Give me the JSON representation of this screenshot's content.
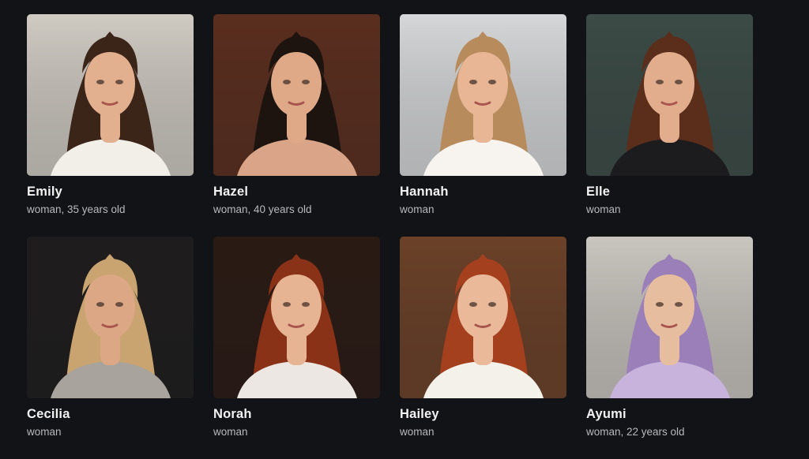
{
  "profiles": [
    {
      "name": "Emily",
      "meta": "woman, 35 years old",
      "bg": "#cfcac2",
      "hair": "#3b2418",
      "skin": "#e3b08f",
      "top": "#f2eee8"
    },
    {
      "name": "Hazel",
      "meta": "woman, 40 years old",
      "bg": "#5a2e1e",
      "hair": "#1d1410",
      "skin": "#dfa988",
      "top": "#d9a487"
    },
    {
      "name": "Hannah",
      "meta": "woman",
      "bg": "#d6d7d8",
      "hair": "#b78b5c",
      "skin": "#e8b694",
      "top": "#f7f3ee"
    },
    {
      "name": "Elle",
      "meta": "woman",
      "bg": "#3c4b46",
      "hair": "#5a2e1b",
      "skin": "#e2ad8c",
      "top": "#1c1c1f"
    },
    {
      "name": "Cecilia",
      "meta": "woman",
      "bg": "#1e1c1c",
      "hair": "#c9a470",
      "skin": "#dca785",
      "top": "#a8a39c"
    },
    {
      "name": "Norah",
      "meta": "woman",
      "bg": "#2a1a14",
      "hair": "#8a3217",
      "skin": "#e6b393",
      "top": "#ece7e2"
    },
    {
      "name": "Hailey",
      "meta": "woman",
      "bg": "#6b4128",
      "hair": "#a5401e",
      "skin": "#e9b99a",
      "top": "#f4f0ea"
    },
    {
      "name": "Ayumi",
      "meta": "woman, 22 years old",
      "bg": "#c9c5bf",
      "hair": "#9b7fb8",
      "skin": "#e7bd9f",
      "top": "#c8b3dd"
    }
  ]
}
